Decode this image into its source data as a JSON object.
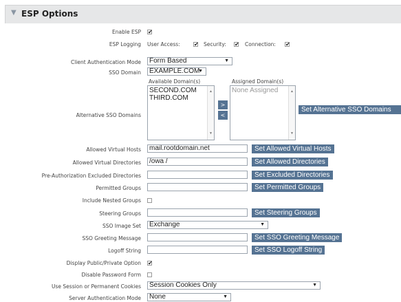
{
  "panel": {
    "title": "ESP Options",
    "collapse_icon": "triangle-down-icon"
  },
  "enable_esp": {
    "label": "Enable ESP",
    "checked": true
  },
  "esp_logging": {
    "label": "ESP Logging",
    "user_access": "User Access:",
    "security": "Security:",
    "connection": "Connection:"
  },
  "client_auth": {
    "label": "Client Authentication Mode",
    "value": "Form Based"
  },
  "sso_domain": {
    "label": "SSO Domain",
    "value": "EXAMPLE.COM"
  },
  "alt_sso": {
    "label": "Alternative SSO Domains",
    "available_header": "Available Domain(s)",
    "assigned_header": "Assigned Domain(s)",
    "available": [
      "SECOND.COM",
      "THIRD.COM"
    ],
    "assigned": [
      "None Assigned"
    ],
    "add_glyph": ">",
    "remove_glyph": "<",
    "button": "Set Alternative SSO Domains"
  },
  "allowed_hosts": {
    "label": "Allowed Virtual Hosts",
    "value": "mail.rootdomain.net",
    "button": "Set Allowed Virtual Hosts"
  },
  "allowed_dirs": {
    "label": "Allowed Virtual Directories",
    "value": "/owa /",
    "button": "Set Allowed Directories"
  },
  "preauth_excluded": {
    "label": "Pre-Authorization Excluded Directories",
    "value": "",
    "button": "Set Excluded Directories"
  },
  "permitted_groups": {
    "label": "Permitted Groups",
    "value": "",
    "button": "Set Permitted Groups"
  },
  "nested_groups": {
    "label": "Include Nested Groups"
  },
  "steering_groups": {
    "label": "Steering Groups",
    "value": "",
    "button": "Set Steering Groups"
  },
  "sso_image": {
    "label": "SSO Image Set",
    "value": "Exchange"
  },
  "greeting": {
    "label": "SSO Greeting Message",
    "value": "",
    "button": "Set SSO Greeting Message"
  },
  "logoff": {
    "label": "Logoff String",
    "value": "",
    "button": "Set SSO Logoff String"
  },
  "public_private": {
    "label": "Display Public/Private Option"
  },
  "disable_pw": {
    "label": "Disable Password Form"
  },
  "cookies": {
    "label": "Use Session or Permanent Cookies",
    "value": "Session Cookies Only"
  },
  "server_auth": {
    "label": "Server Authentication Mode",
    "value": "None"
  }
}
